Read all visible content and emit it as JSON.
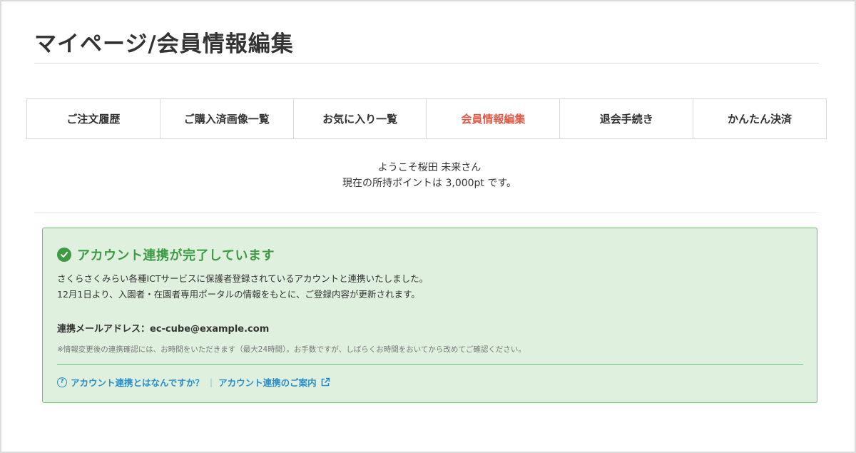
{
  "page": {
    "title": "マイページ/会員情報編集"
  },
  "tabs": [
    {
      "label": "ご注文履歴",
      "active": false
    },
    {
      "label": "ご購入済画像一覧",
      "active": false
    },
    {
      "label": "お気に入り一覧",
      "active": false
    },
    {
      "label": "会員情報編集",
      "active": true
    },
    {
      "label": "退会手続き",
      "active": false
    },
    {
      "label": "かんたん決済",
      "active": false
    }
  ],
  "welcome": {
    "greeting": "ようこそ桜田 未来さん",
    "points": "現在の所持ポイントは 3,000pt です。"
  },
  "notice": {
    "icon": "check-circle-icon",
    "title": "アカウント連携が完了しています",
    "body_line1": "さくらさくみらい各種ICTサービスに保護者登録されているアカウントと連携いたしました。",
    "body_line2": "12月1日より、入園者・在園者専用ポータルの情報をもとに、ご登録内容が更新されます。",
    "mail_label": "連携メールアドレス：",
    "mail_value": "ec-cube@example.com",
    "note": "※情報変更後の連携確認には、お時間をいただきます（最大24時間）。お手数ですが、しばらくお時間をおいてから改めてご確認ください。",
    "link_help": "アカウント連携とはなんですか？",
    "link_guide": "アカウント連携のご案内"
  },
  "colors": {
    "accent": "#e05a47",
    "success": "#3e9a45",
    "link": "#2a8fc9",
    "notice_bg": "#dff0df"
  }
}
